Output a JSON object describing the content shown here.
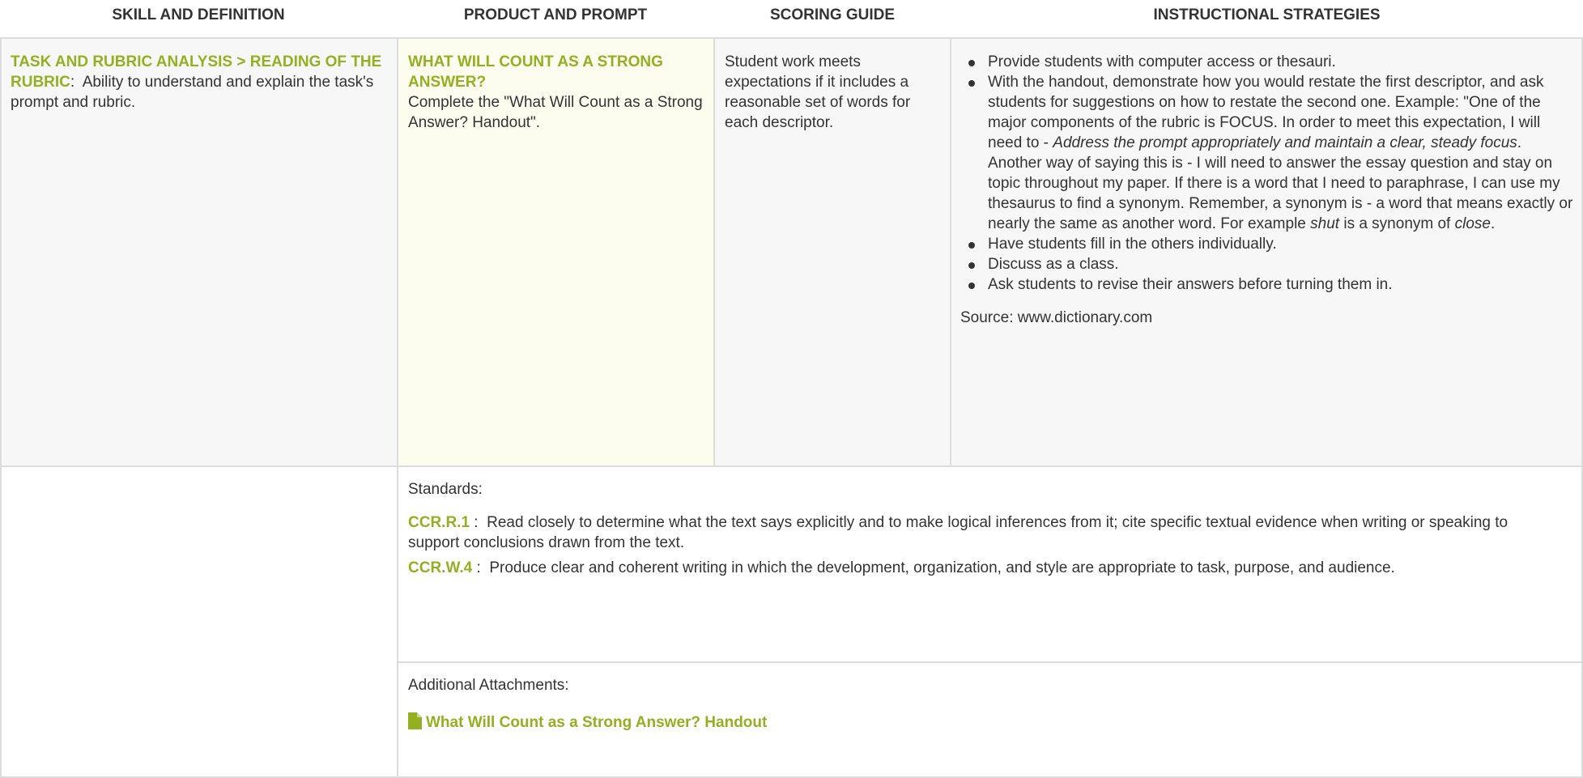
{
  "headers": {
    "skill": "SKILL AND DEFINITION",
    "product": "PRODUCT AND PROMPT",
    "scoring": "SCORING GUIDE",
    "strategies": "INSTRUCTIONAL STRATEGIES"
  },
  "skill": {
    "title": "TASK AND RUBRIC ANALYSIS > READING OF THE RUBRIC",
    "separator": ":",
    "definition": "Ability to understand and explain the task's prompt and rubric."
  },
  "product": {
    "title": "WHAT WILL COUNT AS A STRONG ANSWER?",
    "prompt": "Complete the \"What Will Count as a Strong Answer? Handout\"."
  },
  "scoring": {
    "text": "Student work meets expectations if it includes a reasonable set of words for each descriptor."
  },
  "strategies": {
    "item1": "Provide students with computer access or thesauri.",
    "item2_a": "With the handout, demonstrate how you would restate the first descriptor, and ask students for suggestions on how to restate the second one. Example: \"One of the major components of the rubric is FOCUS. In order to meet this expectation, I will need to - ",
    "item2_b": "Address the prompt appropriately and maintain a clear, steady focus",
    "item2_c": ". Another way of saying this is -  I will need to answer the essay question and stay on topic throughout my paper. If there is a word that I need to paraphrase, I can use my thesaurus to find a synonym. Remember, a synonym is - a word that means exactly or nearly the same as another word. For example ",
    "item2_d": "shut",
    "item2_e": " is a synonym of ",
    "item2_f": "close",
    "item2_g": ".",
    "item3": "Have students fill in the others individually.",
    "item4": "Discuss as a class.",
    "item5": "Ask students to revise their answers before turning them in.",
    "source": "Source: www.dictionary.com"
  },
  "standards": {
    "label": "Standards:",
    "items": [
      {
        "code": "CCR.R.1",
        "sep": " : ",
        "text": "Read closely to determine what the text says explicitly and to make logical inferences from it; cite specific textual evidence when writing or speaking to support conclusions drawn from the text."
      },
      {
        "code": "CCR.W.4",
        "sep": " : ",
        "text": "Produce clear and coherent writing in which the development, organization, and style are appropriate to task, purpose, and audience."
      }
    ]
  },
  "attachments": {
    "label": "Additional Attachments:",
    "icon": "file-icon",
    "link": "What Will Count as a Strong Answer? Handout"
  },
  "colors": {
    "accent": "#93b022",
    "cell_bg": "#f7f7f7",
    "highlight_bg": "#fdfdef",
    "border": "#dcdcdc",
    "text": "#333333"
  }
}
